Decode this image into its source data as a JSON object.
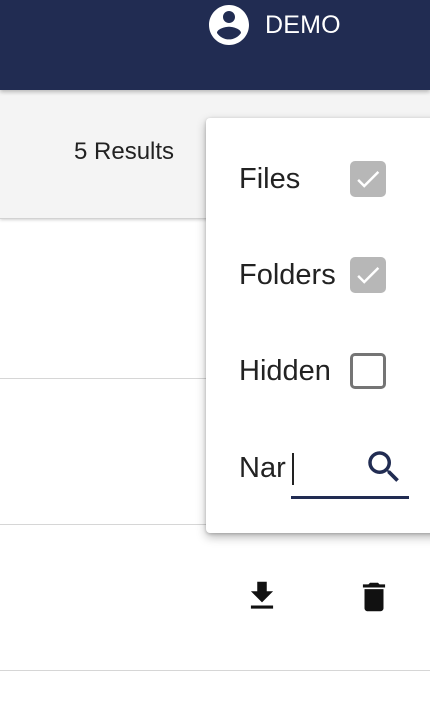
{
  "header": {
    "user_icon": "account-circle-icon",
    "user_name": "DEMO"
  },
  "results": {
    "count_text": "5 Results"
  },
  "rows": [
    {
      "actions": []
    },
    {
      "actions": []
    },
    {
      "actions": [
        "download-icon",
        "delete-icon"
      ]
    }
  ],
  "filter_menu": {
    "items": [
      {
        "label": "Files",
        "checked": true
      },
      {
        "label": "Folders",
        "checked": true
      },
      {
        "label": "Hidden",
        "checked": false
      }
    ],
    "name_field": {
      "value": "Nar",
      "search_icon": "search-icon"
    }
  },
  "colors": {
    "app_bar": "#212c52",
    "checked_box": "#b7b7b7",
    "unchecked_border": "#757575"
  }
}
